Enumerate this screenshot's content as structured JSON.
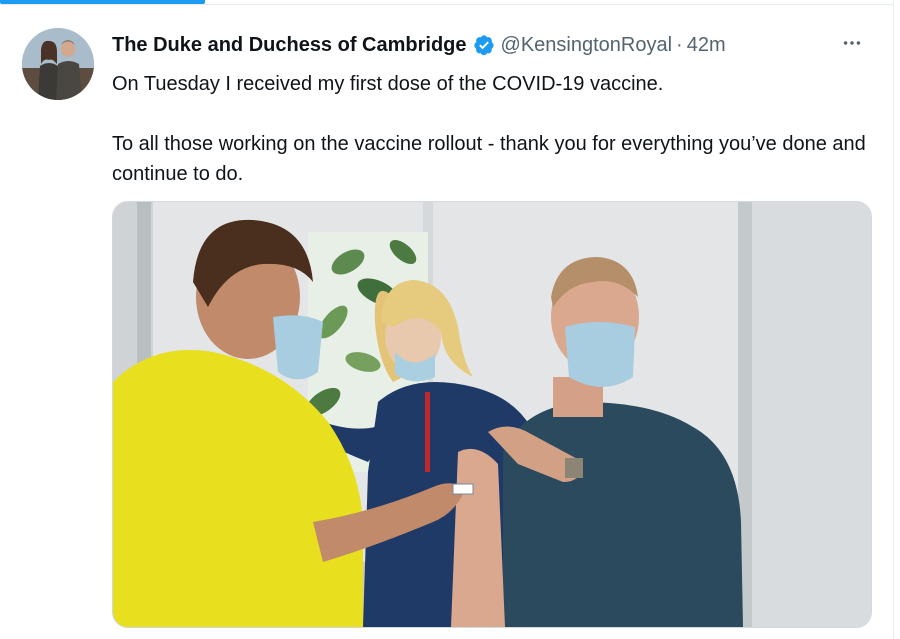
{
  "tweet": {
    "author": {
      "display_name": "The Duke and Duchess of Cambridge",
      "handle": "@KensingtonRoyal",
      "verified": true
    },
    "separator": "·",
    "timestamp": "42m",
    "more_icon": "more-horizontal-icon",
    "text_paragraphs": [
      "On Tuesday I received my first dose of the COVID-19 vaccine.",
      "To all those working on the vaccine rollout - thank you for everything you’ve done and continue to do."
    ]
  },
  "colors": {
    "accent": "#1d9bf0",
    "secondary_text": "#536471",
    "primary_text": "#0f1419",
    "border": "#e6ecf0"
  }
}
